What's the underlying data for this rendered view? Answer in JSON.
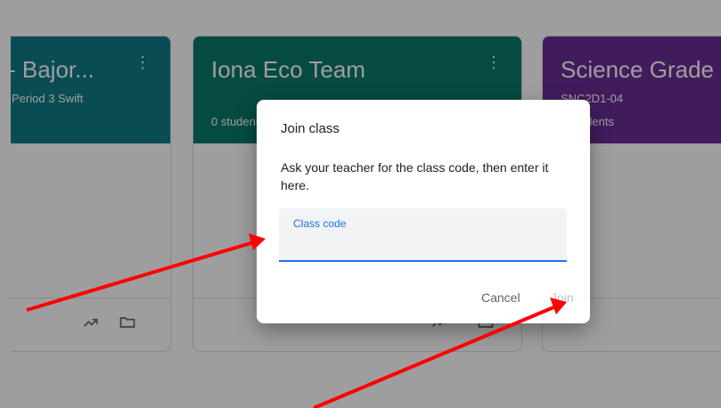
{
  "cards": [
    {
      "title": "- Bajor...",
      "subtitle": "Period 3 Swift",
      "students": "",
      "color": "#0f7b86"
    },
    {
      "title": "Iona Eco Team",
      "subtitle": "",
      "students": "0 students",
      "color": "#0a7a69"
    },
    {
      "title": "Science Grade",
      "subtitle": "SNC2D1-04",
      "students": "0 students",
      "color": "#6a2e96"
    }
  ],
  "card_icons": {
    "more": "more-vertical-icon",
    "trend": "trending-up-icon",
    "folder": "folder-icon"
  },
  "dialog": {
    "title": "Join class",
    "text": "Ask your teacher for the class code, then enter it here.",
    "field_label": "Class code",
    "field_value": "",
    "cancel_label": "Cancel",
    "join_label": "Join"
  },
  "colors": {
    "accent": "#1a73e8",
    "arrow": "#ff0000"
  }
}
